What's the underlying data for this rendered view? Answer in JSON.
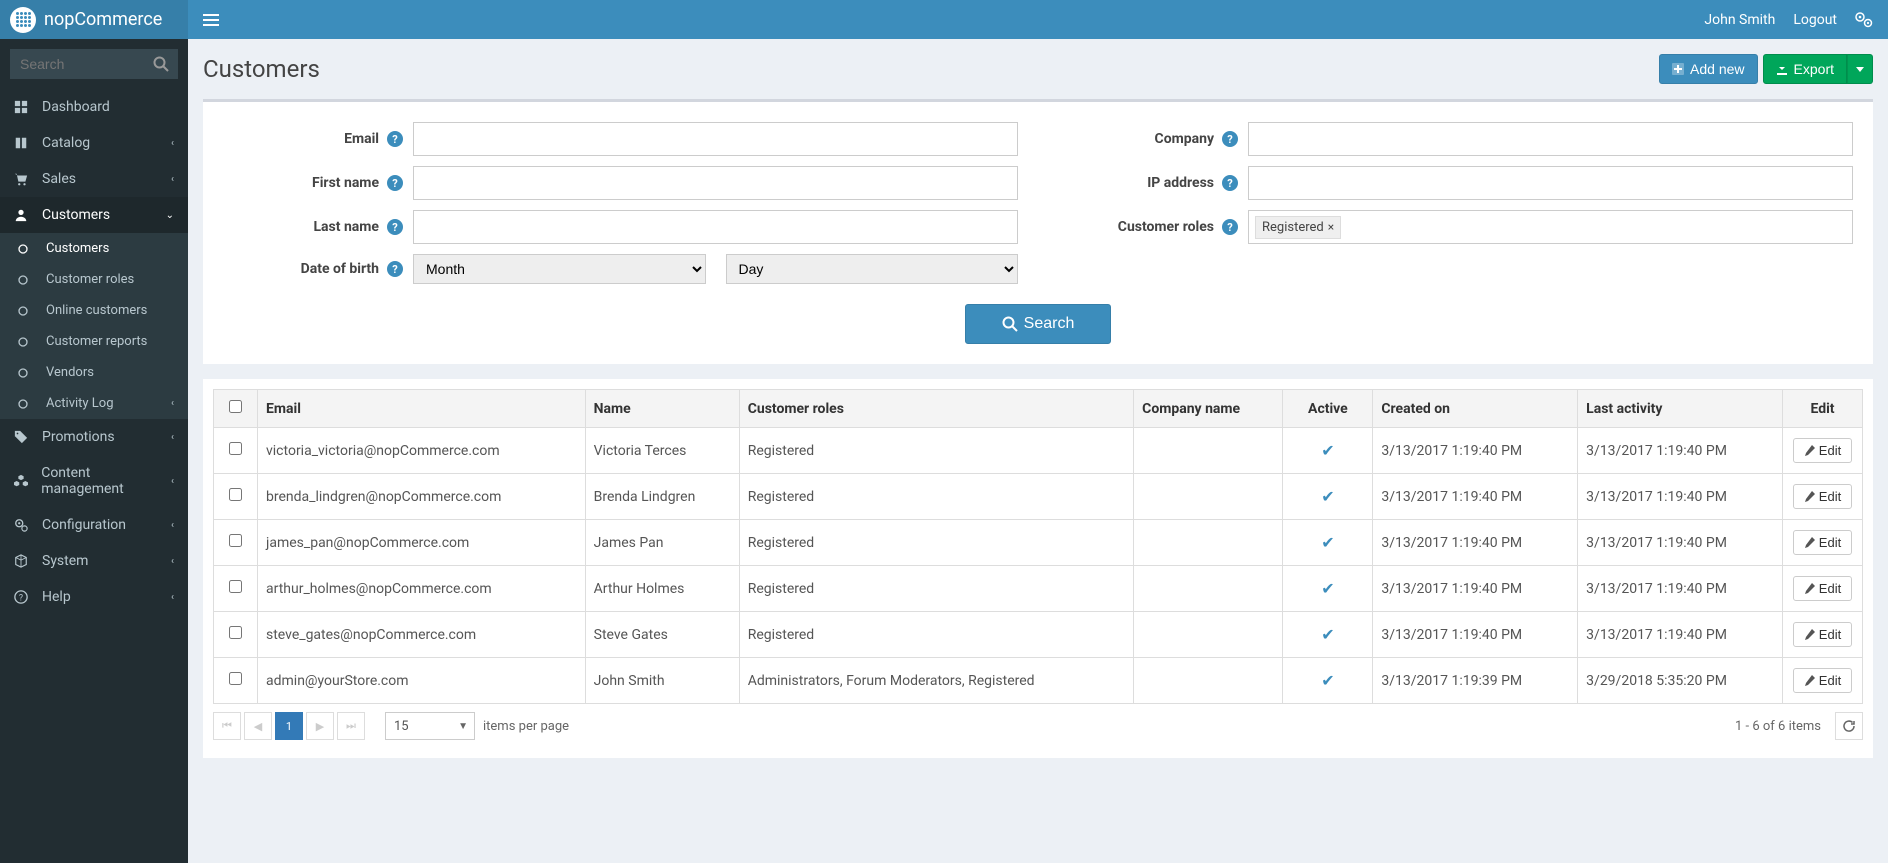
{
  "brand": "nopCommerce",
  "user": {
    "name": "John Smith",
    "logout": "Logout"
  },
  "sidebar": {
    "search_placeholder": "Search",
    "items": [
      {
        "icon": "dashboard",
        "label": "Dashboard",
        "expandable": false
      },
      {
        "icon": "book",
        "label": "Catalog",
        "expandable": true
      },
      {
        "icon": "cart",
        "label": "Sales",
        "expandable": true
      },
      {
        "icon": "user",
        "label": "Customers",
        "expandable": true,
        "active": true,
        "children": [
          {
            "label": "Customers",
            "selected": true
          },
          {
            "label": "Customer roles"
          },
          {
            "label": "Online customers"
          },
          {
            "label": "Customer reports"
          },
          {
            "label": "Vendors"
          },
          {
            "label": "Activity Log",
            "expandable": true
          }
        ]
      },
      {
        "icon": "tags",
        "label": "Promotions",
        "expandable": true
      },
      {
        "icon": "cubes",
        "label": "Content management",
        "expandable": true
      },
      {
        "icon": "cogs",
        "label": "Configuration",
        "expandable": true
      },
      {
        "icon": "cube",
        "label": "System",
        "expandable": true
      },
      {
        "icon": "help",
        "label": "Help",
        "expandable": true
      }
    ]
  },
  "page": {
    "title": "Customers",
    "add_new": "Add new",
    "export": "Export"
  },
  "search": {
    "email_label": "Email",
    "firstname_label": "First name",
    "lastname_label": "Last name",
    "dob_label": "Date of birth",
    "month_placeholder": "Month",
    "day_placeholder": "Day",
    "company_label": "Company",
    "ip_label": "IP address",
    "roles_label": "Customer roles",
    "role_tag": "Registered",
    "button": "Search"
  },
  "table": {
    "headers": {
      "email": "Email",
      "name": "Name",
      "roles": "Customer roles",
      "company": "Company name",
      "active": "Active",
      "created": "Created on",
      "activity": "Last activity",
      "edit": "Edit"
    },
    "rows": [
      {
        "email": "victoria_victoria@nopCommerce.com",
        "name": "Victoria Terces",
        "roles": "Registered",
        "company": "",
        "active": true,
        "created": "3/13/2017 1:19:40 PM",
        "activity": "3/13/2017 1:19:40 PM"
      },
      {
        "email": "brenda_lindgren@nopCommerce.com",
        "name": "Brenda Lindgren",
        "roles": "Registered",
        "company": "",
        "active": true,
        "created": "3/13/2017 1:19:40 PM",
        "activity": "3/13/2017 1:19:40 PM"
      },
      {
        "email": "james_pan@nopCommerce.com",
        "name": "James Pan",
        "roles": "Registered",
        "company": "",
        "active": true,
        "created": "3/13/2017 1:19:40 PM",
        "activity": "3/13/2017 1:19:40 PM"
      },
      {
        "email": "arthur_holmes@nopCommerce.com",
        "name": "Arthur Holmes",
        "roles": "Registered",
        "company": "",
        "active": true,
        "created": "3/13/2017 1:19:40 PM",
        "activity": "3/13/2017 1:19:40 PM"
      },
      {
        "email": "steve_gates@nopCommerce.com",
        "name": "Steve Gates",
        "roles": "Registered",
        "company": "",
        "active": true,
        "created": "3/13/2017 1:19:40 PM",
        "activity": "3/13/2017 1:19:40 PM"
      },
      {
        "email": "admin@yourStore.com",
        "name": "John Smith",
        "roles": "Administrators, Forum Moderators, Registered",
        "company": "",
        "active": true,
        "created": "3/13/2017 1:19:39 PM",
        "activity": "3/29/2018 5:35:20 PM"
      }
    ],
    "edit_label": "Edit"
  },
  "pager": {
    "current": "1",
    "page_size": "15",
    "items_per_page": "items per page",
    "info": "1 - 6 of 6 items"
  }
}
